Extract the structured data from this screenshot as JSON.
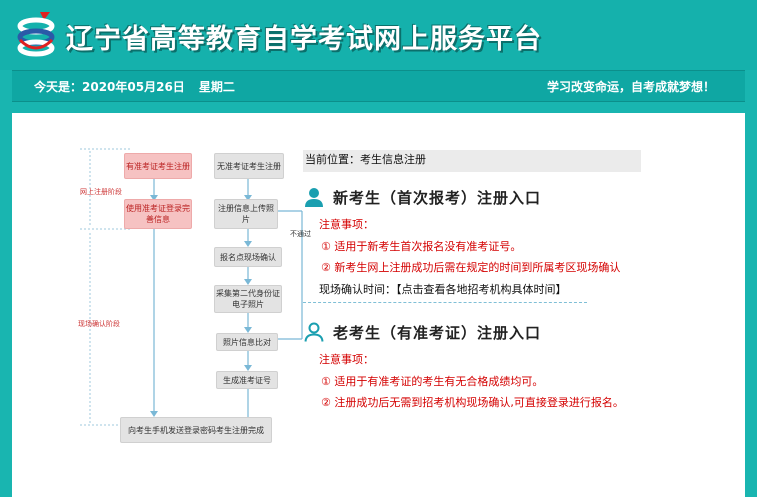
{
  "header": {
    "site_title": "辽宁省高等教育自学考试网上服务平台"
  },
  "infobar": {
    "date": "今天是：2020年05月26日",
    "weekday": "星期二",
    "slogan": "学习改变命运，自考成就梦想！"
  },
  "flowchart": {
    "stage_online": "网上注册阶段",
    "stage_onsite": "现场确认阶段",
    "left_boxes": [
      "有准考证考生注册",
      "使用准考证登录完善信息",
      "向考生手机发送登录密码考生注册完成"
    ],
    "right_boxes": [
      "无准考证考生注册",
      "注册信息上传照片",
      "报名点现场确认",
      "采集第二代身份证电子照片",
      "照片信息比对",
      "生成准考证号"
    ],
    "not_pass": "不通过"
  },
  "breadcrumb": "当前位置：考生信息注册",
  "new_candidate": {
    "title": "新考生（首次报考）注册入口",
    "notice_label": "注意事项：",
    "item1": "① 适用于新考生首次报名没有准考证号。",
    "item2": "② 新考生网上注册成功后需在规定的时间到所属考区现场确认",
    "confirm_label": "现场确认时间：",
    "confirm_link": "【点击查看各地招考机构具体时间】"
  },
  "old_candidate": {
    "title": "老考生（有准考证）注册入口",
    "notice_label": "注意事项：",
    "item1": "① 适用于有准考证的考生有无合格成绩均可。",
    "item2": "② 注册成功后无需到招考机构现场确认,可直接登录进行报名。"
  }
}
